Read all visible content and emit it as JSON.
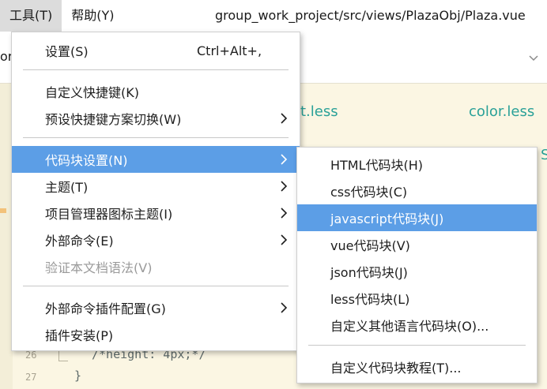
{
  "menubar": {
    "tools": "工具(T)",
    "help": "帮助(Y)"
  },
  "window": {
    "title": "group_work_project/src/views/PlazaObj/Plaza.vue"
  },
  "tabbar": {
    "fragment": "or"
  },
  "editor": {
    "files": [
      "t.less",
      "color.less",
      "S"
    ],
    "line_numbers": [
      "26",
      "27"
    ],
    "code_lines": [
      "/*height: 4px;*/",
      "}"
    ]
  },
  "tools_menu": {
    "items": [
      {
        "label": "设置(S)",
        "shortcut": "Ctrl+Alt+,"
      },
      {
        "label": "自定义快捷键(K)"
      },
      {
        "label": "预设快捷键方案切换(W)"
      },
      {
        "label": "代码块设置(N)"
      },
      {
        "label": "主题(T)"
      },
      {
        "label": "项目管理器图标主题(I)"
      },
      {
        "label": "外部命令(E)"
      },
      {
        "label": "验证本文档语法(V)"
      },
      {
        "label": "外部命令插件配置(G)"
      },
      {
        "label": "插件安装(P)"
      }
    ]
  },
  "snippet_submenu": {
    "items": [
      {
        "label": "HTML代码块(H)"
      },
      {
        "label": "css代码块(C)"
      },
      {
        "label": "javascript代码块(J)"
      },
      {
        "label": "vue代码块(V)"
      },
      {
        "label": "json代码块(J)"
      },
      {
        "label": "less代码块(L)"
      },
      {
        "label": "自定义其他语言代码块(O)..."
      },
      {
        "label": "自定义代码块教程(T)..."
      }
    ]
  },
  "colors": {
    "highlight": "#5c9ee6",
    "editor_bg": "#fbf6e3",
    "link": "#2aa198",
    "disabled_text": "#9a9a9a"
  }
}
